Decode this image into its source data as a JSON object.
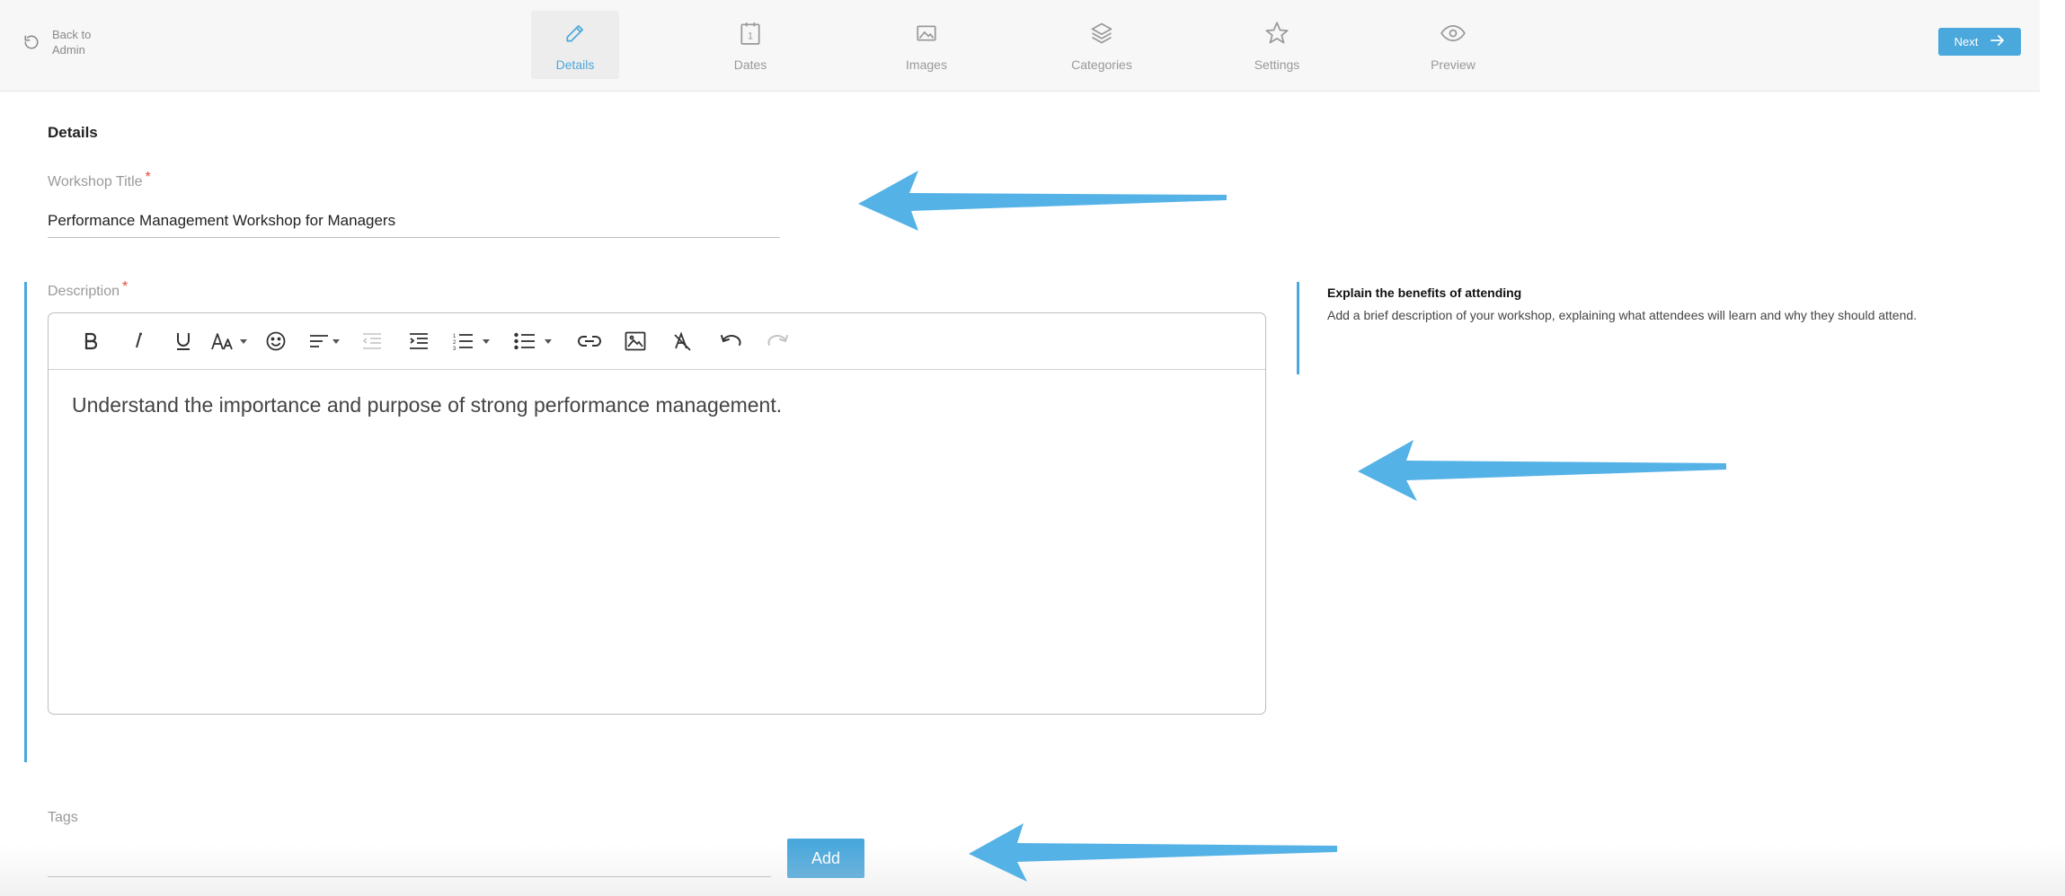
{
  "header": {
    "back_label": "Back to Admin",
    "steps": [
      {
        "label": "Details",
        "icon": "pencil-icon",
        "active": true
      },
      {
        "label": "Dates",
        "icon": "calendar-icon",
        "active": false
      },
      {
        "label": "Images",
        "icon": "image-icon",
        "active": false
      },
      {
        "label": "Categories",
        "icon": "layers-icon",
        "active": false
      },
      {
        "label": "Settings",
        "icon": "star-icon",
        "active": false
      },
      {
        "label": "Preview",
        "icon": "eye-icon",
        "active": false
      }
    ],
    "next_label": "Next"
  },
  "main": {
    "section_title": "Details",
    "workshop_title": {
      "label": "Workshop Title",
      "required_mark": "*",
      "value": "Performance Management Workshop for Managers"
    },
    "description": {
      "label": "Description",
      "required_mark": "*",
      "content": "Understand the importance and purpose of strong performance management.",
      "toolbar": [
        "bold",
        "italic",
        "underline",
        "font-size",
        "emoji",
        "align",
        "outdent",
        "indent",
        "ordered-list",
        "bullet-list",
        "link",
        "image",
        "clear-format",
        "undo",
        "redo"
      ]
    },
    "hint": {
      "title": "Explain the benefits of attending",
      "text": "Add a brief description of your workshop, explaining what attendees will learn and why they should attend."
    },
    "tags": {
      "label": "Tags",
      "value": "",
      "add_label": "Add"
    }
  },
  "colors": {
    "accent": "#4ba8dc",
    "annotation_arrow": "#55b2e6",
    "required": "#e74c3c",
    "header_bg": "#f7f7f7"
  }
}
